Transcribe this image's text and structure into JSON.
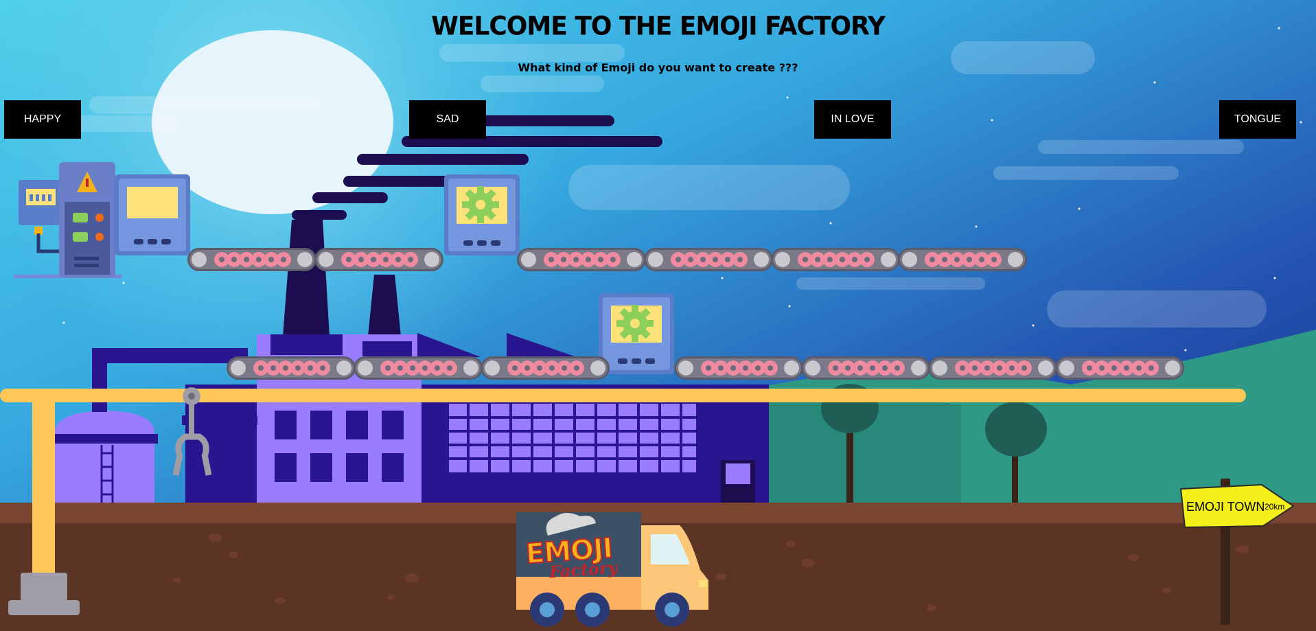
{
  "header": {
    "title": "WELCOME TO THE EMOJI FACTORY",
    "subtitle": "What kind of Emoji do you want to create ???"
  },
  "emoji_buttons": [
    {
      "label": "HAPPY"
    },
    {
      "label": "SAD"
    },
    {
      "label": "IN LOVE"
    },
    {
      "label": "TONGUE"
    }
  ],
  "sign": {
    "label": "EMOJI TOWN",
    "distance": "20km"
  },
  "truck": {
    "logo_top": "EMOJI",
    "logo_bottom": "Factory"
  },
  "colors": {
    "sky_top": "#4cc9e6",
    "sky_bottom": "#1a2e8a",
    "factory": "#9a7dff",
    "factory_dark": "#2a1590",
    "belt": "#6b6b7a",
    "rail": "#ffc857",
    "ground": "#5b3424",
    "button_bg": "#000000",
    "sign": "#f2ef1a"
  },
  "icons": [
    "gear-icon",
    "warning-icon",
    "robotic-claw-icon",
    "delivery-truck-icon",
    "signpost-icon"
  ]
}
